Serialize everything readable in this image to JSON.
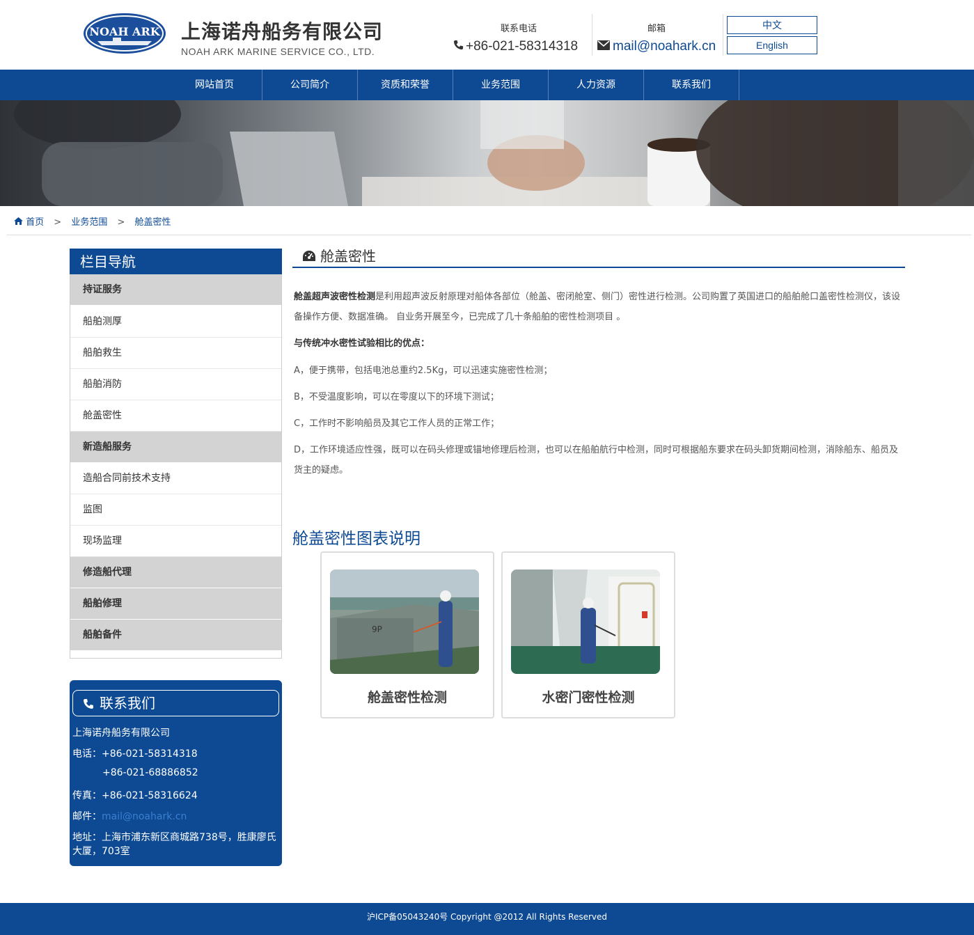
{
  "header": {
    "logo_text": "NOAH ARK",
    "company_cn": "上海诺舟船务有限公司",
    "company_en": "NOAH ARK MARINE SERVICE CO., LTD.",
    "phone_label": "联系电话",
    "phone": "+86-021-58314318",
    "email_label": "邮箱",
    "email": "mail@noahark.cn",
    "lang_cn": "中文",
    "lang_en": "English"
  },
  "nav": {
    "items": [
      "网站首页",
      "公司简介",
      "资质和荣誉",
      "业务范围",
      "人力资源",
      "联系我们"
    ]
  },
  "breadcrumb": {
    "home": "首页",
    "sep": ">",
    "level1": "业务范围",
    "level2": "舱盖密性"
  },
  "sidebar": {
    "title": "栏目导航",
    "items": [
      "持证服务",
      "船舶测厚",
      "船舶救生",
      "船舶消防",
      "舱盖密性",
      "新造船服务",
      "造船合同前技术支持",
      "监图",
      "现场监理",
      "修造船代理",
      "船舶修理",
      "船舶备件"
    ]
  },
  "contact": {
    "title": "联系我们",
    "company": "上海诺舟船务有限公司",
    "phone_label": "电话：",
    "phone1": "+86-021-58314318",
    "phone2": "+86-021-68886852",
    "fax_label": "传真：",
    "fax": "+86-021-58316624",
    "mail_label": "邮件：",
    "mail": "mail@noahark.cn",
    "address_label": "地址：",
    "address_line1": "上海市浦东新区商城路738号，胜康廖氏",
    "address_line2": "大厦，703室"
  },
  "main": {
    "title": "舱盖密性",
    "p1_bold": "舱盖超声波密性检测",
    "p1_text": "是利用超声波反射原理对船体各部位（舱盖、密闭舱室、侧门）密性进行检测。公司购置了英国进口的船舶舱口盖密性检测仪，该设备操作方便、数据准确。 自业务开展至今，已完成了几十条船舶的密性检测项目 。",
    "p2_bold": "与传统冲水密性试验相比的优点：",
    "pA": "A，便于携带，包括电池总重约2.5Kg，可以迅速实施密性检测；",
    "pB": "B，不受温度影响，可以在零度以下的环境下测试；",
    "pC": "C，工作时不影响船员及其它工作人员的正常工作；",
    "pD": "D，工作环境适应性强，既可以在码头修理或锚地修理后检测，也可以在船舶航行中检测，同时可根据船东要求在码头卸货期间检测，消除船东、船员及货主的疑虑。",
    "gallery_title": "舱盖密性图表说明",
    "cards": [
      {
        "caption": "舱盖密性检测"
      },
      {
        "caption": "水密门密性检测"
      }
    ]
  },
  "footer": {
    "text": "沪ICP备05043240号 Copyright @2012 All Rights Reserved"
  },
  "colors": {
    "brand_blue": "#0d4a93",
    "sidebar_category_bg": "#d3d3d3",
    "footer_bg": "#0d4a93"
  },
  "icons": {
    "phone": "phone-icon",
    "mail": "envelope-icon",
    "home": "home-icon",
    "title": "dashboard-icon"
  }
}
